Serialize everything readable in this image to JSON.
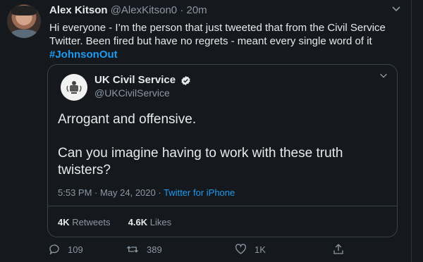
{
  "tweet": {
    "name": "Alex Kitson",
    "handle": "@AlexKitson0",
    "separator": "·",
    "time": "20m",
    "text_line1": "Hi everyone - I’m the person that just tweeted that from the Civil Service",
    "text_line2": "Twitter. Been fired but have no regrets - meant every single word of it",
    "hashtag": "#JohnsonOut"
  },
  "quoted": {
    "name": "UK Civil Service",
    "handle": "@UKCivilService",
    "line1": "Arrogant and offensive.",
    "line2": "Can you imagine having to work with these truth",
    "line3": "twisters?",
    "timestamp": "5:53 PM · May 24, 2020 ·",
    "source": "Twitter for iPhone",
    "retweets_count": "4K",
    "retweets_label": "Retweets",
    "likes_count": "4.6K",
    "likes_label": "Likes"
  },
  "actions": {
    "replies": "109",
    "retweets": "389",
    "likes": "1K"
  },
  "colors": {
    "background": "#15181c",
    "accent": "#1d9bf0",
    "border": "#38444d",
    "muted": "#8b98a5"
  },
  "icons": [
    "chevron-down-icon",
    "verified-badge-icon",
    "crest-icon",
    "reply-icon",
    "retweet-icon",
    "like-icon",
    "share-icon"
  ]
}
